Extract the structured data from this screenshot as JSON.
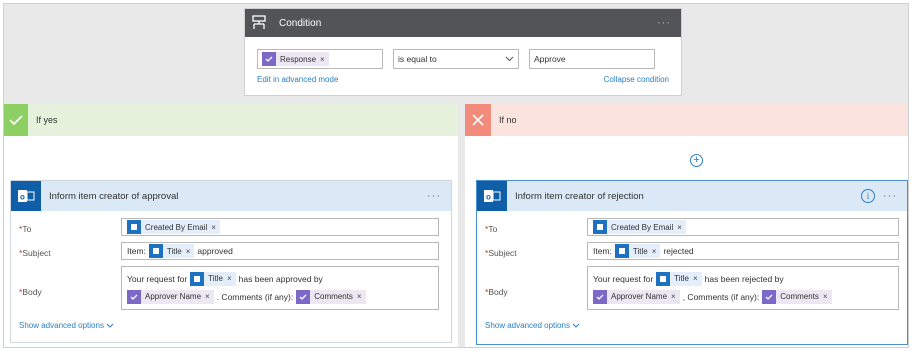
{
  "condition": {
    "title": "Condition",
    "icon": "condition-icon",
    "more": "···",
    "left_token": "Response",
    "operator": "is equal to",
    "value": "Approve",
    "edit_link": "Edit in advanced mode",
    "collapse_link": "Collapse condition"
  },
  "yes_branch": {
    "label": "If yes",
    "action": {
      "title": "Inform item creator of approval",
      "more": "···",
      "to_label": "To",
      "to_token": "Created By Email",
      "subject_label": "Subject",
      "subject_prefix": "Item:",
      "subject_token": "Title",
      "subject_suffix": "approved",
      "body_label": "Body",
      "body_pre": "Your request for",
      "body_token_title": "Title",
      "body_mid": "has been approved by",
      "body_token_approver": "Approver Name",
      "body_comments_text": ". Comments (if any):",
      "body_token_comments": "Comments",
      "advanced": "Show advanced options"
    }
  },
  "no_branch": {
    "label": "If no",
    "action": {
      "title": "Inform item creator of rejection",
      "more": "···",
      "to_label": "To",
      "to_token": "Created By Email",
      "subject_label": "Subject",
      "subject_prefix": "Item:",
      "subject_token": "Title",
      "subject_suffix": "rejected",
      "body_label": "Body",
      "body_pre": "Your request for",
      "body_token_title": "Title",
      "body_mid": "has been rejected by",
      "body_token_approver": "Approver Name",
      "body_comments_text": ", Comments (if any):",
      "body_token_comments": "Comments",
      "advanced": "Show advanced options"
    }
  },
  "token_close": "×",
  "colors": {
    "accent": "#2b7fc6",
    "outlook": "#0f5fa8",
    "approvals": "#7a69c7",
    "yes": "#8ccf62",
    "no": "#f28b7c"
  }
}
